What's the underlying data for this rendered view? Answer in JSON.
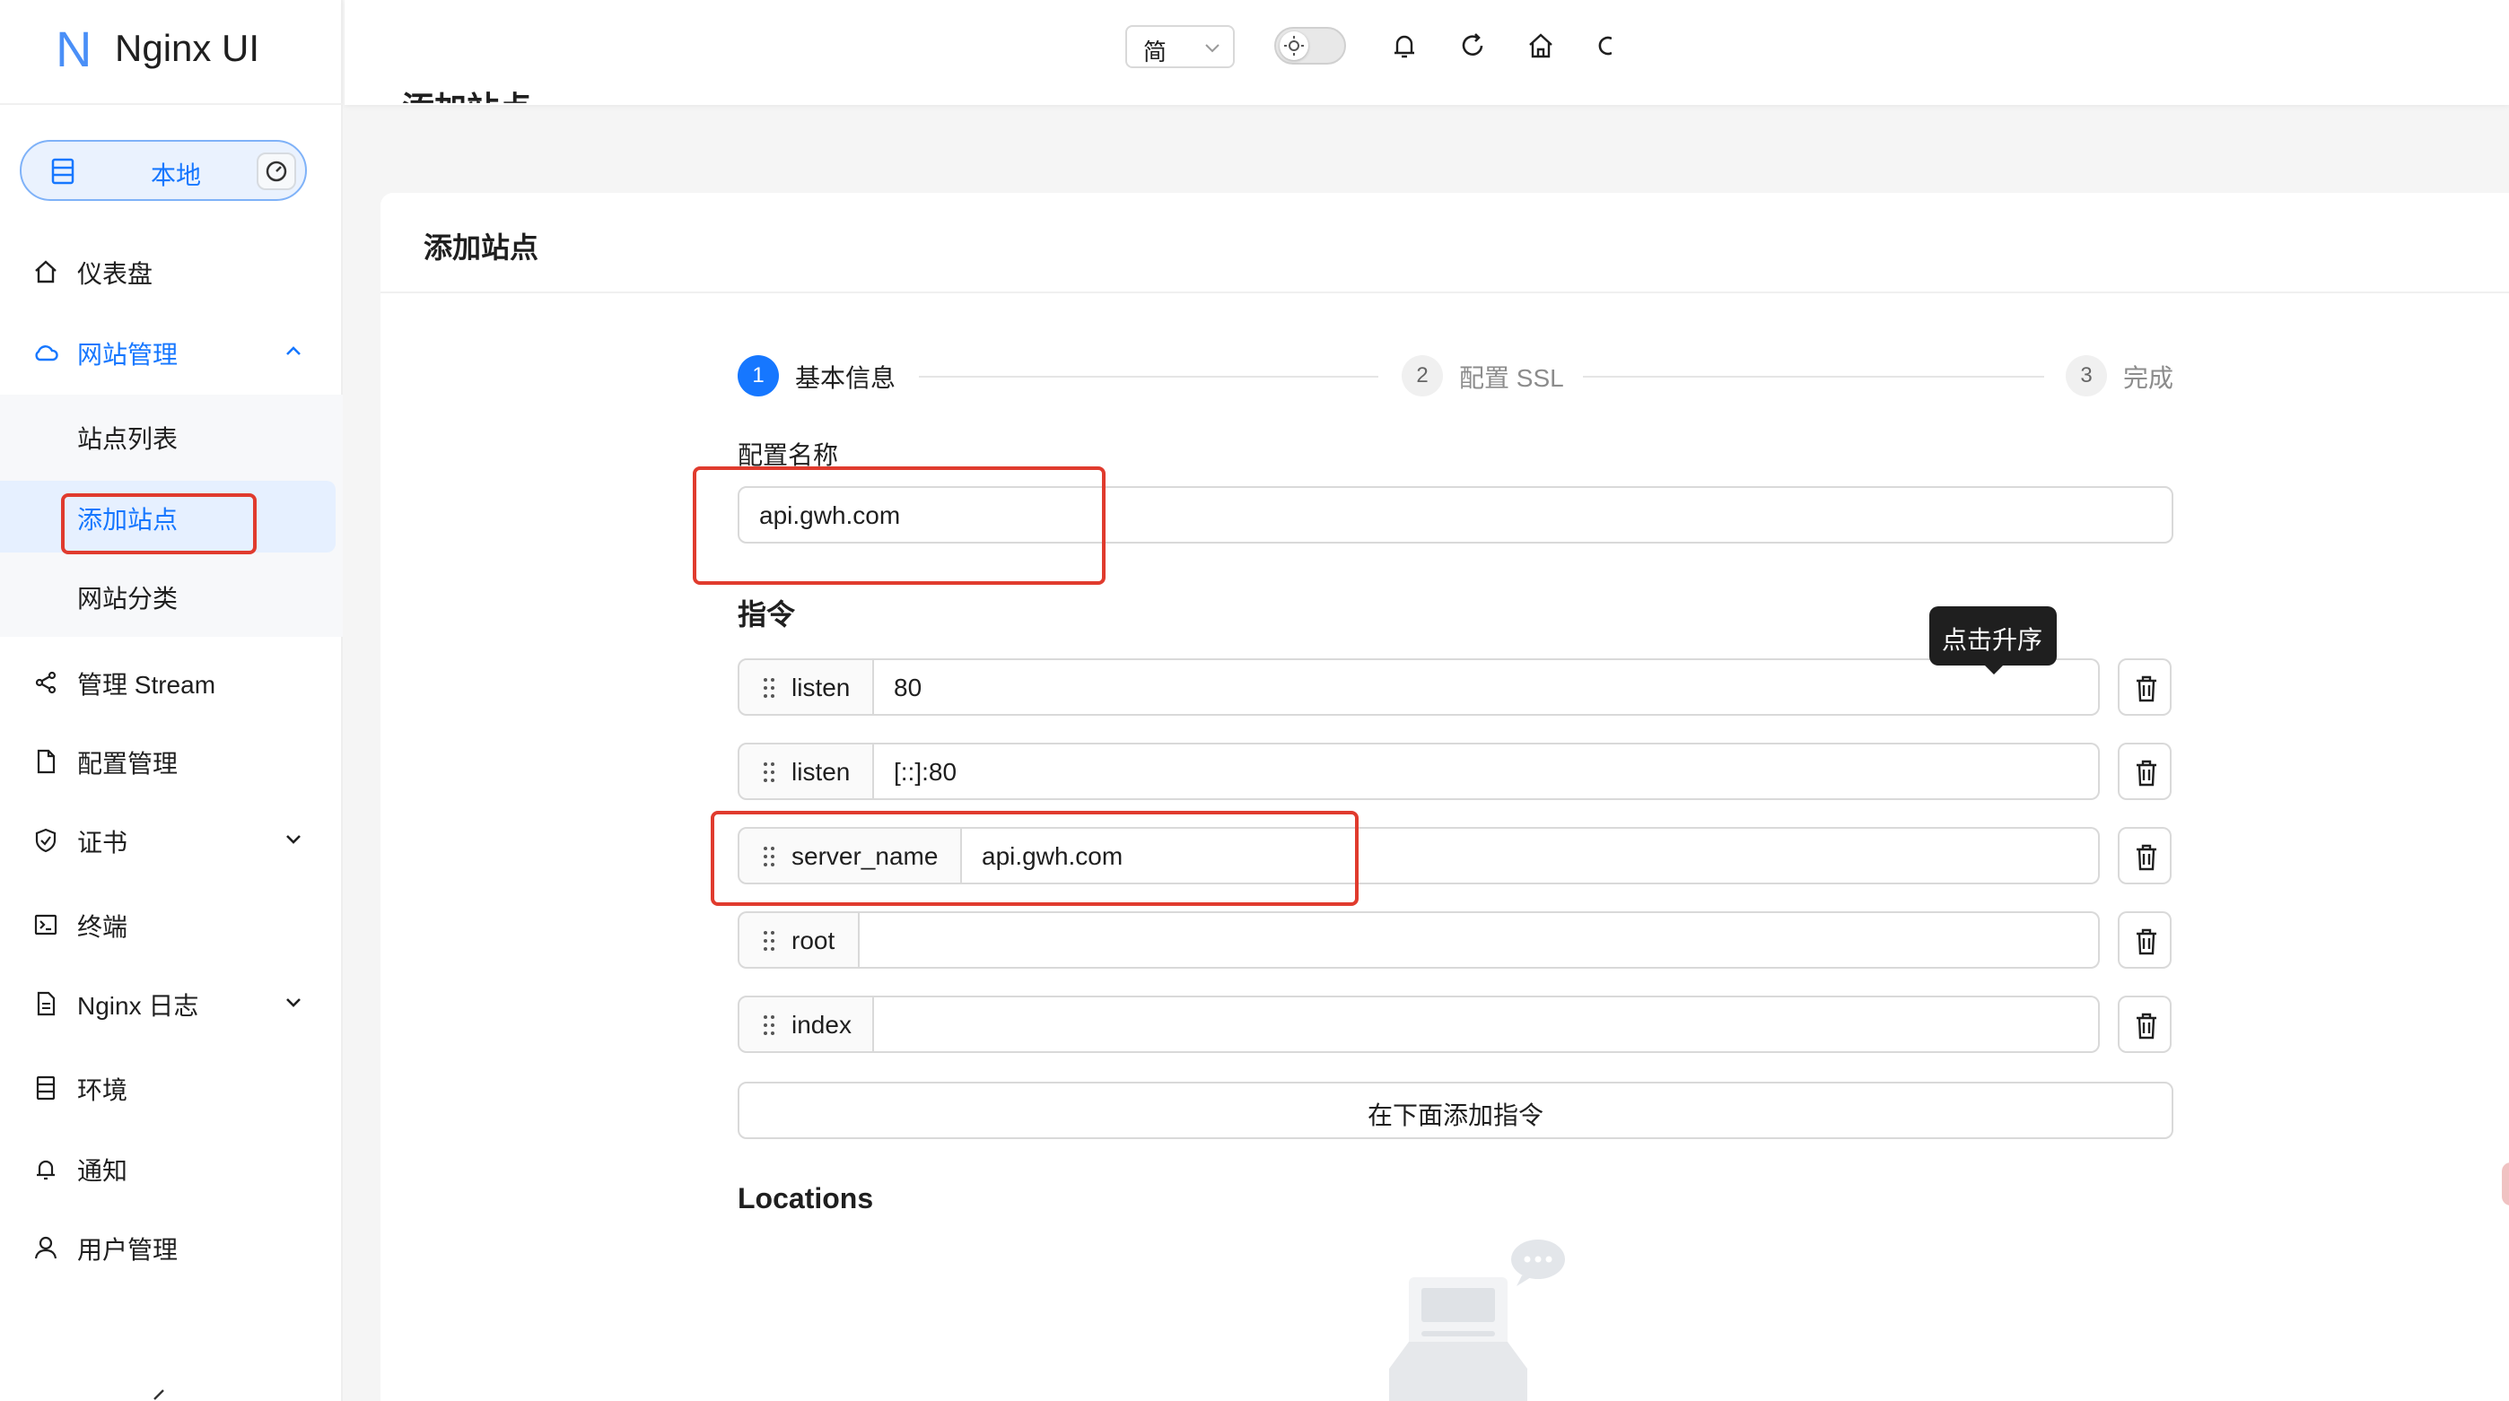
{
  "app": {
    "logo_letter": "N",
    "logo_text": "Nginx UI"
  },
  "environment": {
    "label": "本地",
    "db_icon": "database-icon",
    "gauge_icon": "dashboard-gauge-icon"
  },
  "sidebar": {
    "items": [
      {
        "label": "仪表盘",
        "icon": "home-icon"
      },
      {
        "label": "网站管理",
        "icon": "cloud-icon",
        "expanded": true
      },
      {
        "label": "管理 Stream",
        "icon": "share-icon"
      },
      {
        "label": "配置管理",
        "icon": "file-icon"
      },
      {
        "label": "证书",
        "icon": "shield-icon"
      },
      {
        "label": "终端",
        "icon": "terminal-icon"
      },
      {
        "label": "Nginx 日志",
        "icon": "log-file-icon"
      },
      {
        "label": "环境",
        "icon": "server-icon"
      },
      {
        "label": "通知",
        "icon": "bell-icon"
      },
      {
        "label": "用户管理",
        "icon": "user-icon"
      }
    ],
    "site_submenu": [
      {
        "label": "站点列表"
      },
      {
        "label": "添加站点",
        "selected": true
      },
      {
        "label": "网站分类"
      }
    ]
  },
  "header": {
    "page_title": "添加站点",
    "language": "简",
    "icons": [
      "sun-icon",
      "bell-icon",
      "refresh-icon",
      "home-icon",
      "logout-icon"
    ]
  },
  "card": {
    "title": "添加站点"
  },
  "steps": [
    {
      "num": "1",
      "label": "基本信息",
      "status": "active"
    },
    {
      "num": "2",
      "label": "配置 SSL",
      "status": "wait"
    },
    {
      "num": "3",
      "label": "完成",
      "status": "wait"
    }
  ],
  "form": {
    "config_name_label": "配置名称",
    "config_name_value": "api.gwh.com",
    "directives_title": "指令",
    "directives": [
      {
        "name": "listen",
        "value": "80"
      },
      {
        "name": "listen",
        "value": "[::]:80"
      },
      {
        "name": "server_name",
        "value": "api.gwh.com"
      },
      {
        "name": "root",
        "value": ""
      },
      {
        "name": "index",
        "value": ""
      }
    ],
    "add_directive_label": "在下面添加指令",
    "locations_title": "Locations",
    "sort_tooltip": "点击升序"
  },
  "colors": {
    "primary": "#1677ff",
    "highlight": "#e03b2e"
  }
}
